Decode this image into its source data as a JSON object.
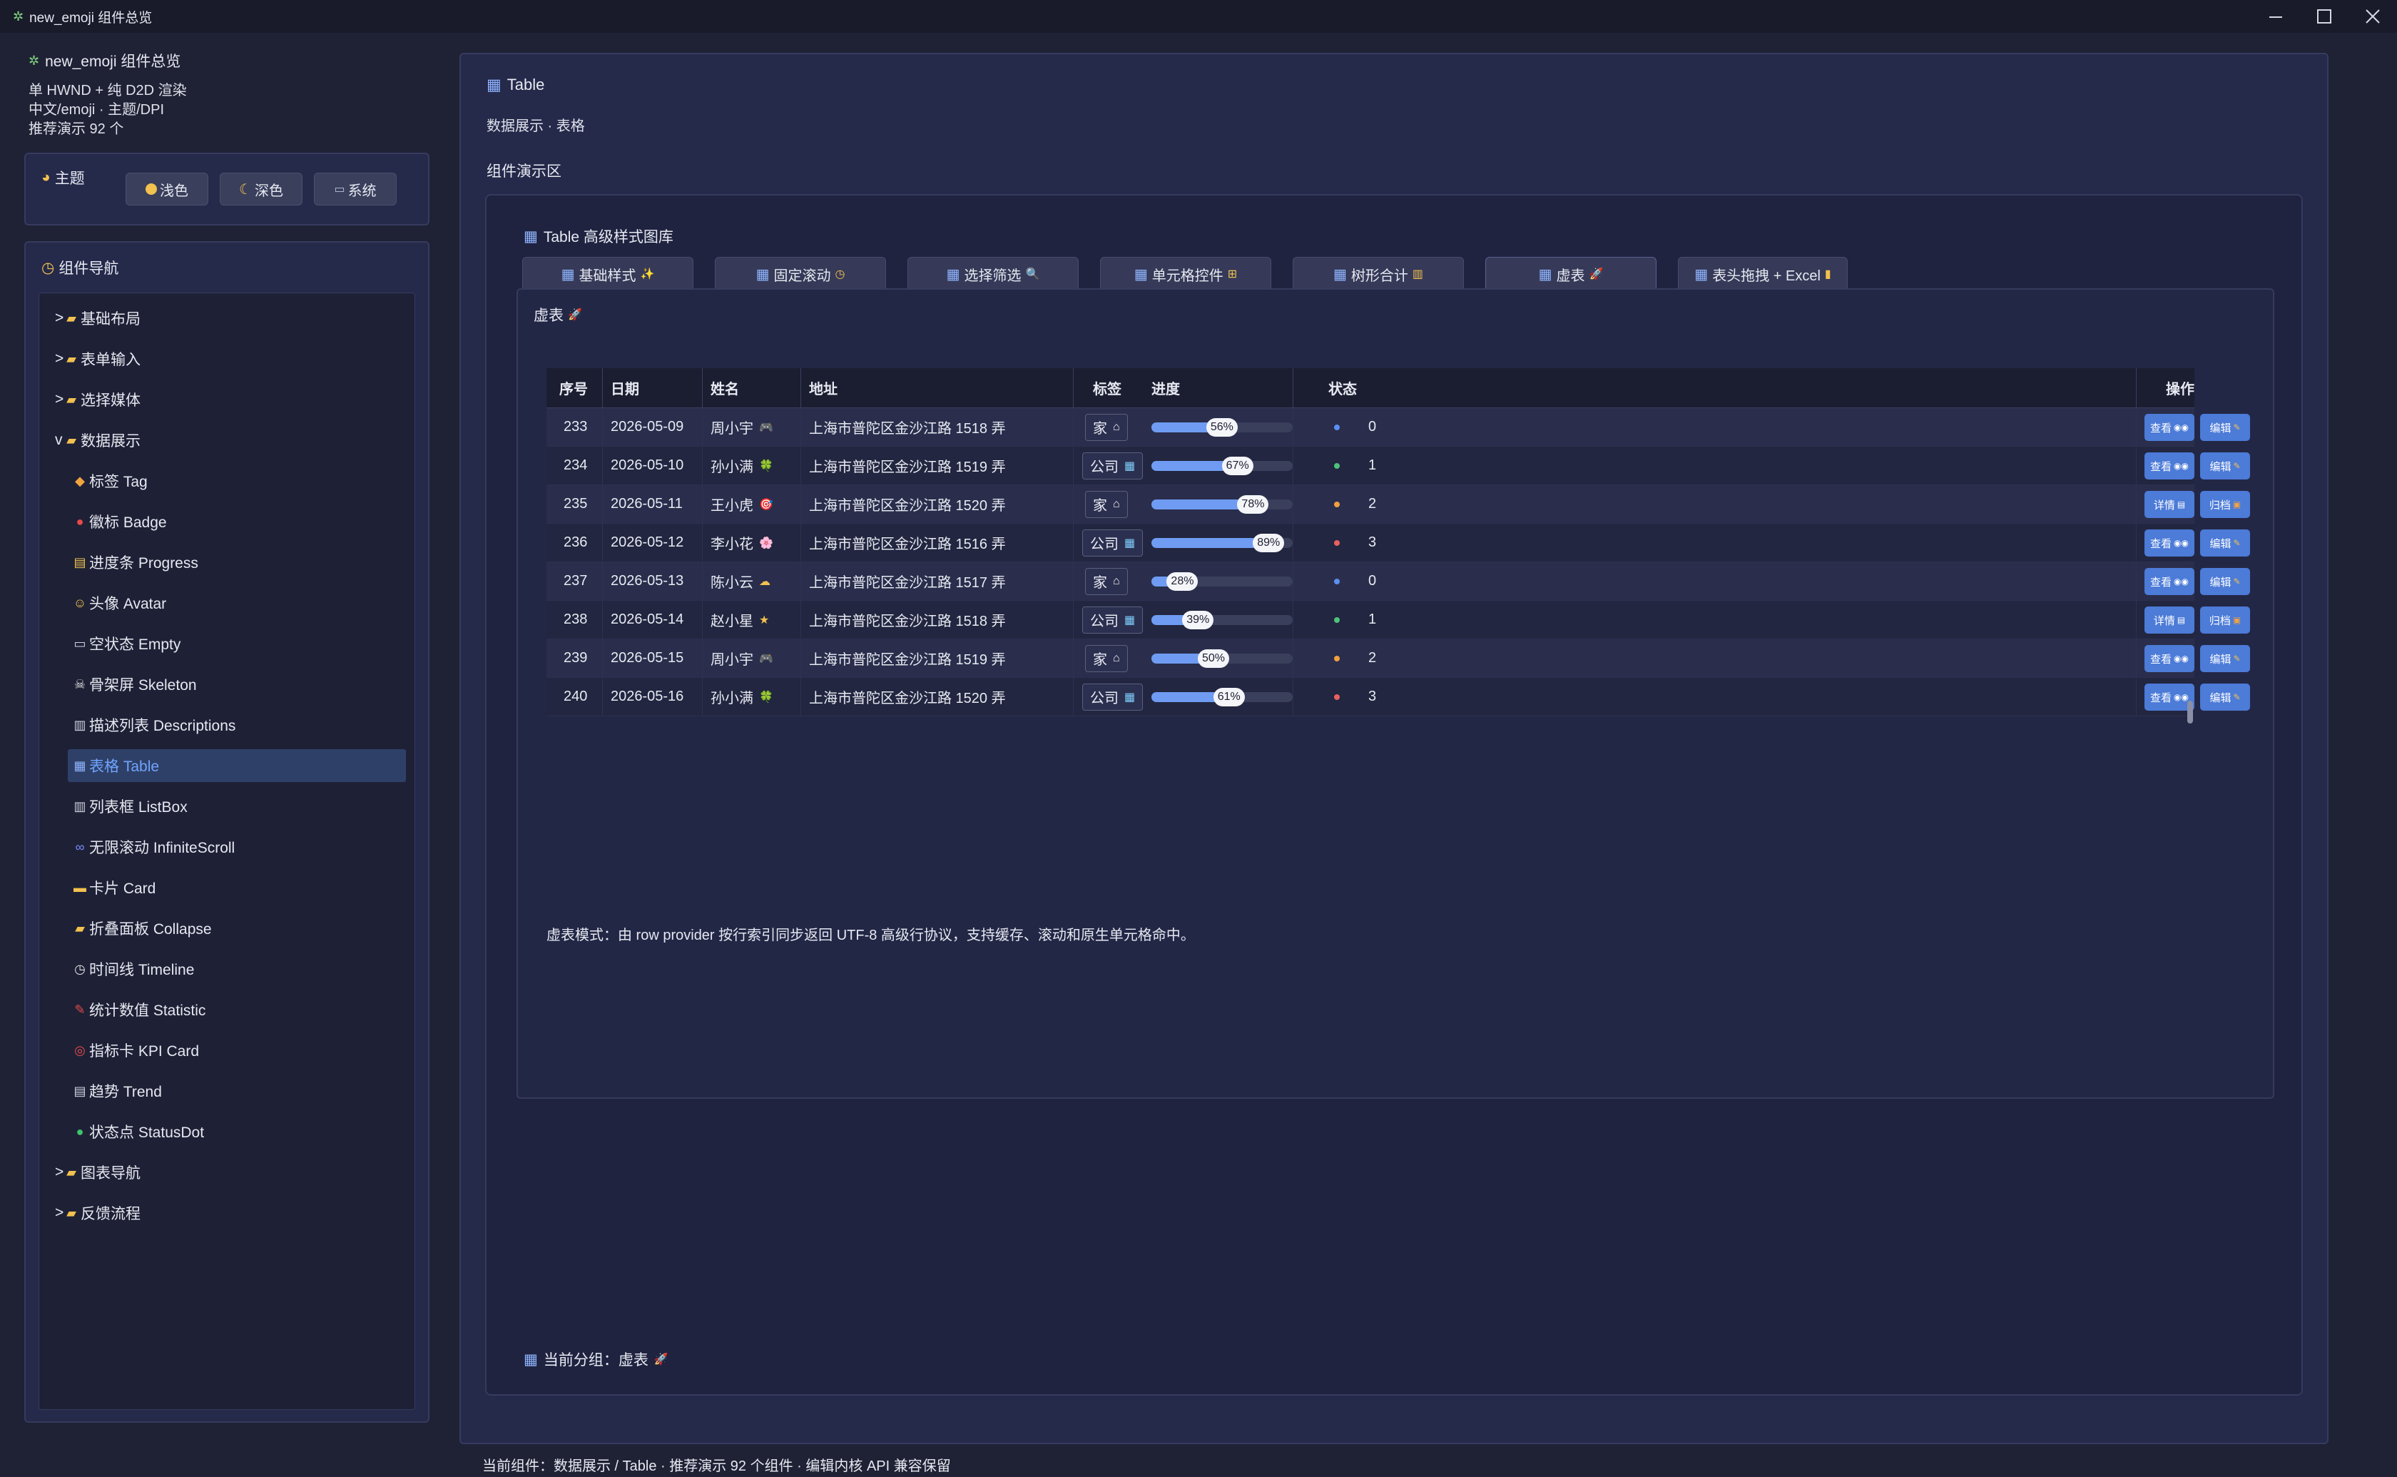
{
  "window": {
    "title": "new_emoji 组件总览",
    "app_icon": "sparkle-icon"
  },
  "sidebar": {
    "app_name": "new_emoji 组件总览",
    "meta_lines": [
      "单 HWND + 纯 D2D 渲染",
      "中文/emoji · 主题/DPI",
      "推荐演示 92 个"
    ],
    "theme": {
      "label": "主题",
      "buttons": [
        {
          "label": "浅色",
          "icon": "yellow-circle-icon"
        },
        {
          "label": "深色",
          "icon": "moon-icon"
        },
        {
          "label": "系统",
          "icon": "laptop-icon"
        }
      ]
    },
    "nav_title": "组件导航",
    "nav": [
      {
        "label": "基础布局",
        "prefix": ">",
        "type": "group"
      },
      {
        "label": "表单输入",
        "prefix": ">",
        "type": "group"
      },
      {
        "label": "选择媒体",
        "prefix": ">",
        "type": "group"
      },
      {
        "label": "数据展示",
        "prefix": "v",
        "type": "group"
      },
      {
        "label": "标签 Tag",
        "icon": "◆",
        "type": "child"
      },
      {
        "label": "徽标 Badge",
        "icon": "●",
        "type": "child"
      },
      {
        "label": "进度条 Progress",
        "icon": "▤",
        "type": "child"
      },
      {
        "label": "头像 Avatar",
        "icon": "☺",
        "type": "child"
      },
      {
        "label": "空状态 Empty",
        "icon": "▭",
        "type": "child"
      },
      {
        "label": "骨架屏 Skeleton",
        "icon": "☠",
        "type": "child"
      },
      {
        "label": "描述列表 Descriptions",
        "icon": "▥",
        "type": "child"
      },
      {
        "label": "表格 Table",
        "icon": "▦",
        "type": "child",
        "active": true
      },
      {
        "label": "列表框 ListBox",
        "icon": "▥",
        "type": "child"
      },
      {
        "label": "无限滚动 InfiniteScroll",
        "icon": "∞",
        "type": "child"
      },
      {
        "label": "卡片 Card",
        "icon": "▬",
        "type": "child"
      },
      {
        "label": "折叠面板 Collapse",
        "icon": "▰",
        "type": "child"
      },
      {
        "label": "时间线 Timeline",
        "icon": "◷",
        "type": "child"
      },
      {
        "label": "统计数值 Statistic",
        "icon": "✎",
        "type": "child"
      },
      {
        "label": "指标卡 KPI Card",
        "icon": "◎",
        "type": "child"
      },
      {
        "label": "趋势 Trend",
        "icon": "▤",
        "type": "child"
      },
      {
        "label": "状态点 StatusDot",
        "icon": "●",
        "type": "child"
      },
      {
        "label": "图表导航",
        "prefix": ">",
        "type": "group"
      },
      {
        "label": "反馈流程",
        "prefix": ">",
        "type": "group"
      }
    ]
  },
  "main": {
    "title": "Table",
    "subtitle": "数据展示 · 表格",
    "demo_label": "组件演示区",
    "gallery_title": "Table 高级样式图库",
    "tabs": [
      {
        "label": "基础样式",
        "suffix": "✨"
      },
      {
        "label": "固定滚动",
        "suffix": "◷"
      },
      {
        "label": "选择筛选",
        "suffix": "🔍"
      },
      {
        "label": "单元格控件",
        "suffix": "⊞"
      },
      {
        "label": "树形合计",
        "suffix": "▥"
      },
      {
        "label": "虚表",
        "suffix": "🚀"
      },
      {
        "label": "表头拖拽 + Excel",
        "suffix": "▮"
      }
    ],
    "group_name": "虚表",
    "table": {
      "columns": [
        "序号",
        "日期",
        "姓名",
        "地址",
        "标签",
        "进度",
        "状态",
        "操作"
      ],
      "rows": [
        {
          "id": "233",
          "date": "2026-05-09",
          "name": "周小宇",
          "name_icon": "🎮",
          "addr": "上海市普陀区金沙江路 1518 弄",
          "tag": "家",
          "tag_icon": "house-icon",
          "progress": 56,
          "progress_text": "56%",
          "status_color": "#5b8ff0",
          "status": "0",
          "actions": [
            {
              "label": "查看",
              "icon": "eyes-icon"
            },
            {
              "label": "编辑",
              "icon": "pencil-icon"
            }
          ]
        },
        {
          "id": "234",
          "date": "2026-05-10",
          "name": "孙小满",
          "name_icon": "🍀",
          "addr": "上海市普陀区金沙江路 1519 弄",
          "tag": "公司",
          "tag_icon": "office-icon",
          "progress": 67,
          "progress_text": "67%",
          "status_color": "#4ec27a",
          "status": "1",
          "actions": [
            {
              "label": "查看",
              "icon": "eyes-icon"
            },
            {
              "label": "编辑",
              "icon": "pencil-icon"
            }
          ]
        },
        {
          "id": "235",
          "date": "2026-05-11",
          "name": "王小虎",
          "name_icon": "🎯",
          "addr": "上海市普陀区金沙江路 1520 弄",
          "tag": "家",
          "tag_icon": "house-icon",
          "progress": 78,
          "progress_text": "78%",
          "status_color": "#f0a040",
          "status": "2",
          "actions": [
            {
              "label": "详情",
              "icon": "doc-icon"
            },
            {
              "label": "归档",
              "icon": "box-icon"
            }
          ]
        },
        {
          "id": "236",
          "date": "2026-05-12",
          "name": "李小花",
          "name_icon": "🌸",
          "addr": "上海市普陀区金沙江路 1516 弄",
          "tag": "公司",
          "tag_icon": "office-icon",
          "progress": 89,
          "progress_text": "89%",
          "status_color": "#e86060",
          "status": "3",
          "actions": [
            {
              "label": "查看",
              "icon": "eyes-icon"
            },
            {
              "label": "编辑",
              "icon": "pencil-icon"
            }
          ]
        },
        {
          "id": "237",
          "date": "2026-05-13",
          "name": "陈小云",
          "name_icon": "☁",
          "addr": "上海市普陀区金沙江路 1517 弄",
          "tag": "家",
          "tag_icon": "house-icon",
          "progress": 28,
          "progress_text": "28%",
          "status_color": "#5b8ff0",
          "status": "0",
          "actions": [
            {
              "label": "查看",
              "icon": "eyes-icon"
            },
            {
              "label": "编辑",
              "icon": "pencil-icon"
            }
          ]
        },
        {
          "id": "238",
          "date": "2026-05-14",
          "name": "赵小星",
          "name_icon": "★",
          "addr": "上海市普陀区金沙江路 1518 弄",
          "tag": "公司",
          "tag_icon": "office-icon",
          "progress": 39,
          "progress_text": "39%",
          "status_color": "#4ec27a",
          "status": "1",
          "actions": [
            {
              "label": "详情",
              "icon": "doc-icon"
            },
            {
              "label": "归档",
              "icon": "box-icon"
            }
          ]
        },
        {
          "id": "239",
          "date": "2026-05-15",
          "name": "周小宇",
          "name_icon": "🎮",
          "addr": "上海市普陀区金沙江路 1519 弄",
          "tag": "家",
          "tag_icon": "house-icon",
          "progress": 50,
          "progress_text": "50%",
          "status_color": "#f0a040",
          "status": "2",
          "actions": [
            {
              "label": "查看",
              "icon": "eyes-icon"
            },
            {
              "label": "编辑",
              "icon": "pencil-icon"
            }
          ]
        },
        {
          "id": "240",
          "date": "2026-05-16",
          "name": "孙小满",
          "name_icon": "🍀",
          "addr": "上海市普陀区金沙江路 1520 弄",
          "tag": "公司",
          "tag_icon": "office-icon",
          "progress": 61,
          "progress_text": "61%",
          "status_color": "#e86060",
          "status": "3",
          "actions": [
            {
              "label": "查看",
              "icon": "eyes-icon"
            },
            {
              "label": "编辑",
              "icon": "pencil-icon"
            }
          ]
        }
      ]
    },
    "virtual_note": "虚表模式：由 row provider 按行索引同步返回 UTF-8 高级行协议，支持缓存、滚动和原生单元格命中。",
    "current_group": "当前分组：虚表"
  },
  "status_bar": "当前组件：数据展示 / Table · 推荐演示 92 个组件 · 编辑内核 API 兼容保留",
  "colors": {
    "accent": "#4c7bd8",
    "progress": "#6f9cf2",
    "active_nav_text": "#6fa4ff"
  }
}
